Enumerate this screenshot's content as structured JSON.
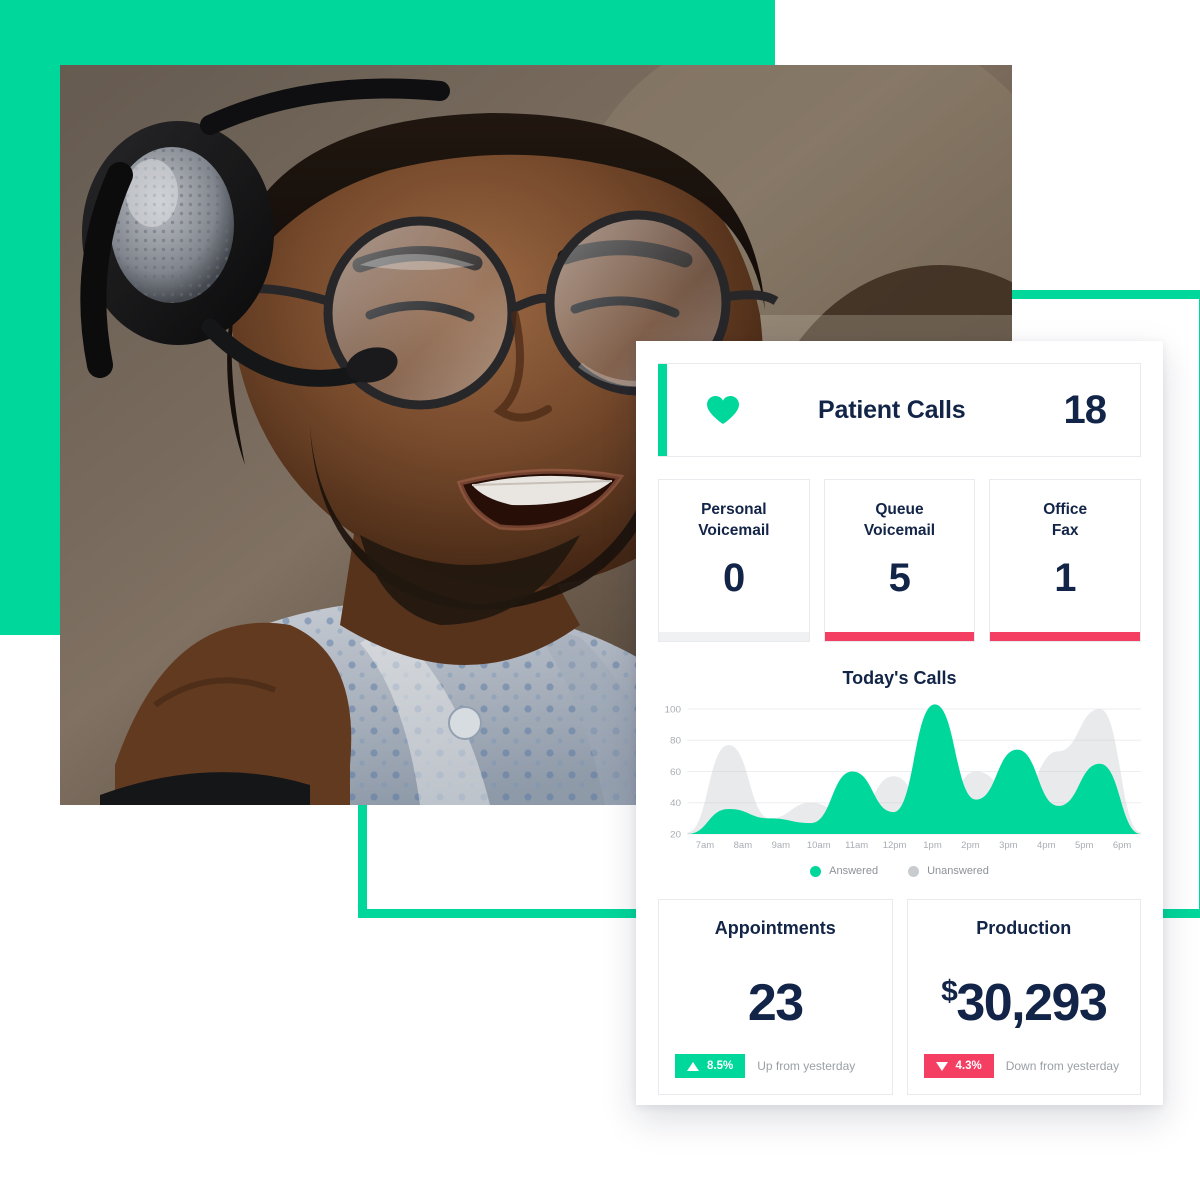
{
  "theme": {
    "green": "#00D79B",
    "red": "#F43F63",
    "navy": "#122447",
    "gray_bar": "#f0f1f2",
    "muted_text": "#9aa0a6"
  },
  "decor": {
    "green_block_name": "green-square-decoration",
    "green_frame_name": "green-outline-frame-decoration",
    "photo_alt": "Smiling call-center agent wearing a headset and glasses"
  },
  "dashboard": {
    "header": {
      "icon": "heart-icon",
      "title": "Patient Calls",
      "value": "18"
    },
    "stats": [
      {
        "label": "Personal\nVoicemail",
        "label_line1": "Personal",
        "label_line2": "Voicemail",
        "value": "0",
        "underline": "gray"
      },
      {
        "label": "Queue\nVoicemail",
        "label_line1": "Queue",
        "label_line2": "Voicemail",
        "value": "5",
        "underline": "red"
      },
      {
        "label": "Office\nFax",
        "label_line1": "Office",
        "label_line2": "Fax",
        "value": "1",
        "underline": "red"
      }
    ],
    "metrics": [
      {
        "title": "Appointments",
        "currency": "",
        "value": "23",
        "badge_direction": "up",
        "badge_icon": "triangle-up-icon",
        "badge_value": "8.5%",
        "note": "Up from yesterday"
      },
      {
        "title": "Production",
        "currency": "$",
        "value": "30,293",
        "badge_direction": "down",
        "badge_icon": "triangle-down-icon",
        "badge_value": "4.3%",
        "note": "Down from yesterday"
      }
    ]
  },
  "chart_data": {
    "type": "area",
    "title": "Today's Calls",
    "xlabel": "",
    "ylabel": "",
    "grid": true,
    "legend_position": "bottom",
    "ylim": [
      20,
      100
    ],
    "yticks": [
      20,
      40,
      60,
      80,
      100
    ],
    "x": [
      "7am",
      "8am",
      "9am",
      "10am",
      "11am",
      "12pm",
      "1pm",
      "2pm",
      "3pm",
      "4pm",
      "5pm",
      "6pm"
    ],
    "series": [
      {
        "name": "Answered",
        "color": "#00D79B",
        "values": [
          20,
          36,
          30,
          27,
          60,
          34,
          103,
          42,
          74,
          38,
          65,
          20
        ]
      },
      {
        "name": "Unanswered",
        "color": "#c9cccf",
        "values": [
          21,
          77,
          30,
          40,
          30,
          57,
          30,
          60,
          44,
          73,
          100,
          21
        ]
      }
    ]
  }
}
